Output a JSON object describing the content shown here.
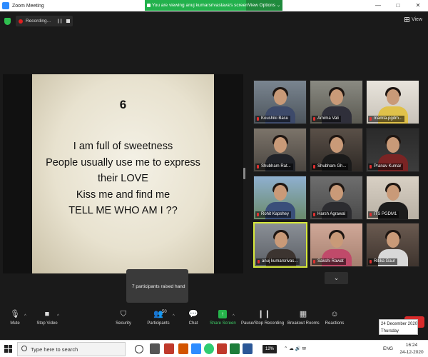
{
  "window": {
    "title": "Zoom Meeting",
    "controls": [
      "—",
      "□",
      "✕"
    ]
  },
  "banner": {
    "message": "You are viewing anuj kumarsrivastava's screen",
    "view_options": "View Options ⌄"
  },
  "recording": {
    "label": "Recording..."
  },
  "view_button": {
    "label": "View"
  },
  "slide": {
    "number": "6",
    "lines": [
      "I am full of sweetness",
      "People usually use me to express",
      "their LOVE",
      "Kiss me and find me",
      "TELL ME WHO AM I ??"
    ]
  },
  "participants": [
    {
      "name": "Koushiki Basu"
    },
    {
      "name": "Amima Vali"
    },
    {
      "name": "mamta.pgdm..."
    },
    {
      "name": "Shubham Rat..."
    },
    {
      "name": "Shubham Gh..."
    },
    {
      "name": "Pranav Kumar"
    },
    {
      "name": "Rohit Kapshey"
    },
    {
      "name": "Harsh Agrawal"
    },
    {
      "name": "ITS PGDM1"
    },
    {
      "name": "anuj kumarsrivas..."
    },
    {
      "name": "Sakshi Rawat"
    },
    {
      "name": "Ritika Gaur"
    }
  ],
  "gallery_next": "⌄",
  "tooltip": {
    "text": "7 participants raised hand"
  },
  "toolbar": {
    "mute": "Mute",
    "stop_video": "Stop Video",
    "security": "Security",
    "participants": "Participants",
    "participants_count": "50",
    "chat": "Chat",
    "share_screen": "Share Screen",
    "pause_recording": "Pause/Stop Recording",
    "breakout_rooms": "Breakout Rooms",
    "reactions": "Reactions"
  },
  "date_popup": {
    "date": "24 December 2020",
    "day": "Thursday"
  },
  "taskbar": {
    "search_placeholder": "Type here to search",
    "battery": "12%",
    "language": "ENG",
    "time": "16:24",
    "date": "24-12-2020"
  },
  "colors": {
    "accent_green": "#22b14c",
    "share_green": "#26b34b",
    "record_red": "#e02020",
    "active_border": "#d6e83a"
  }
}
